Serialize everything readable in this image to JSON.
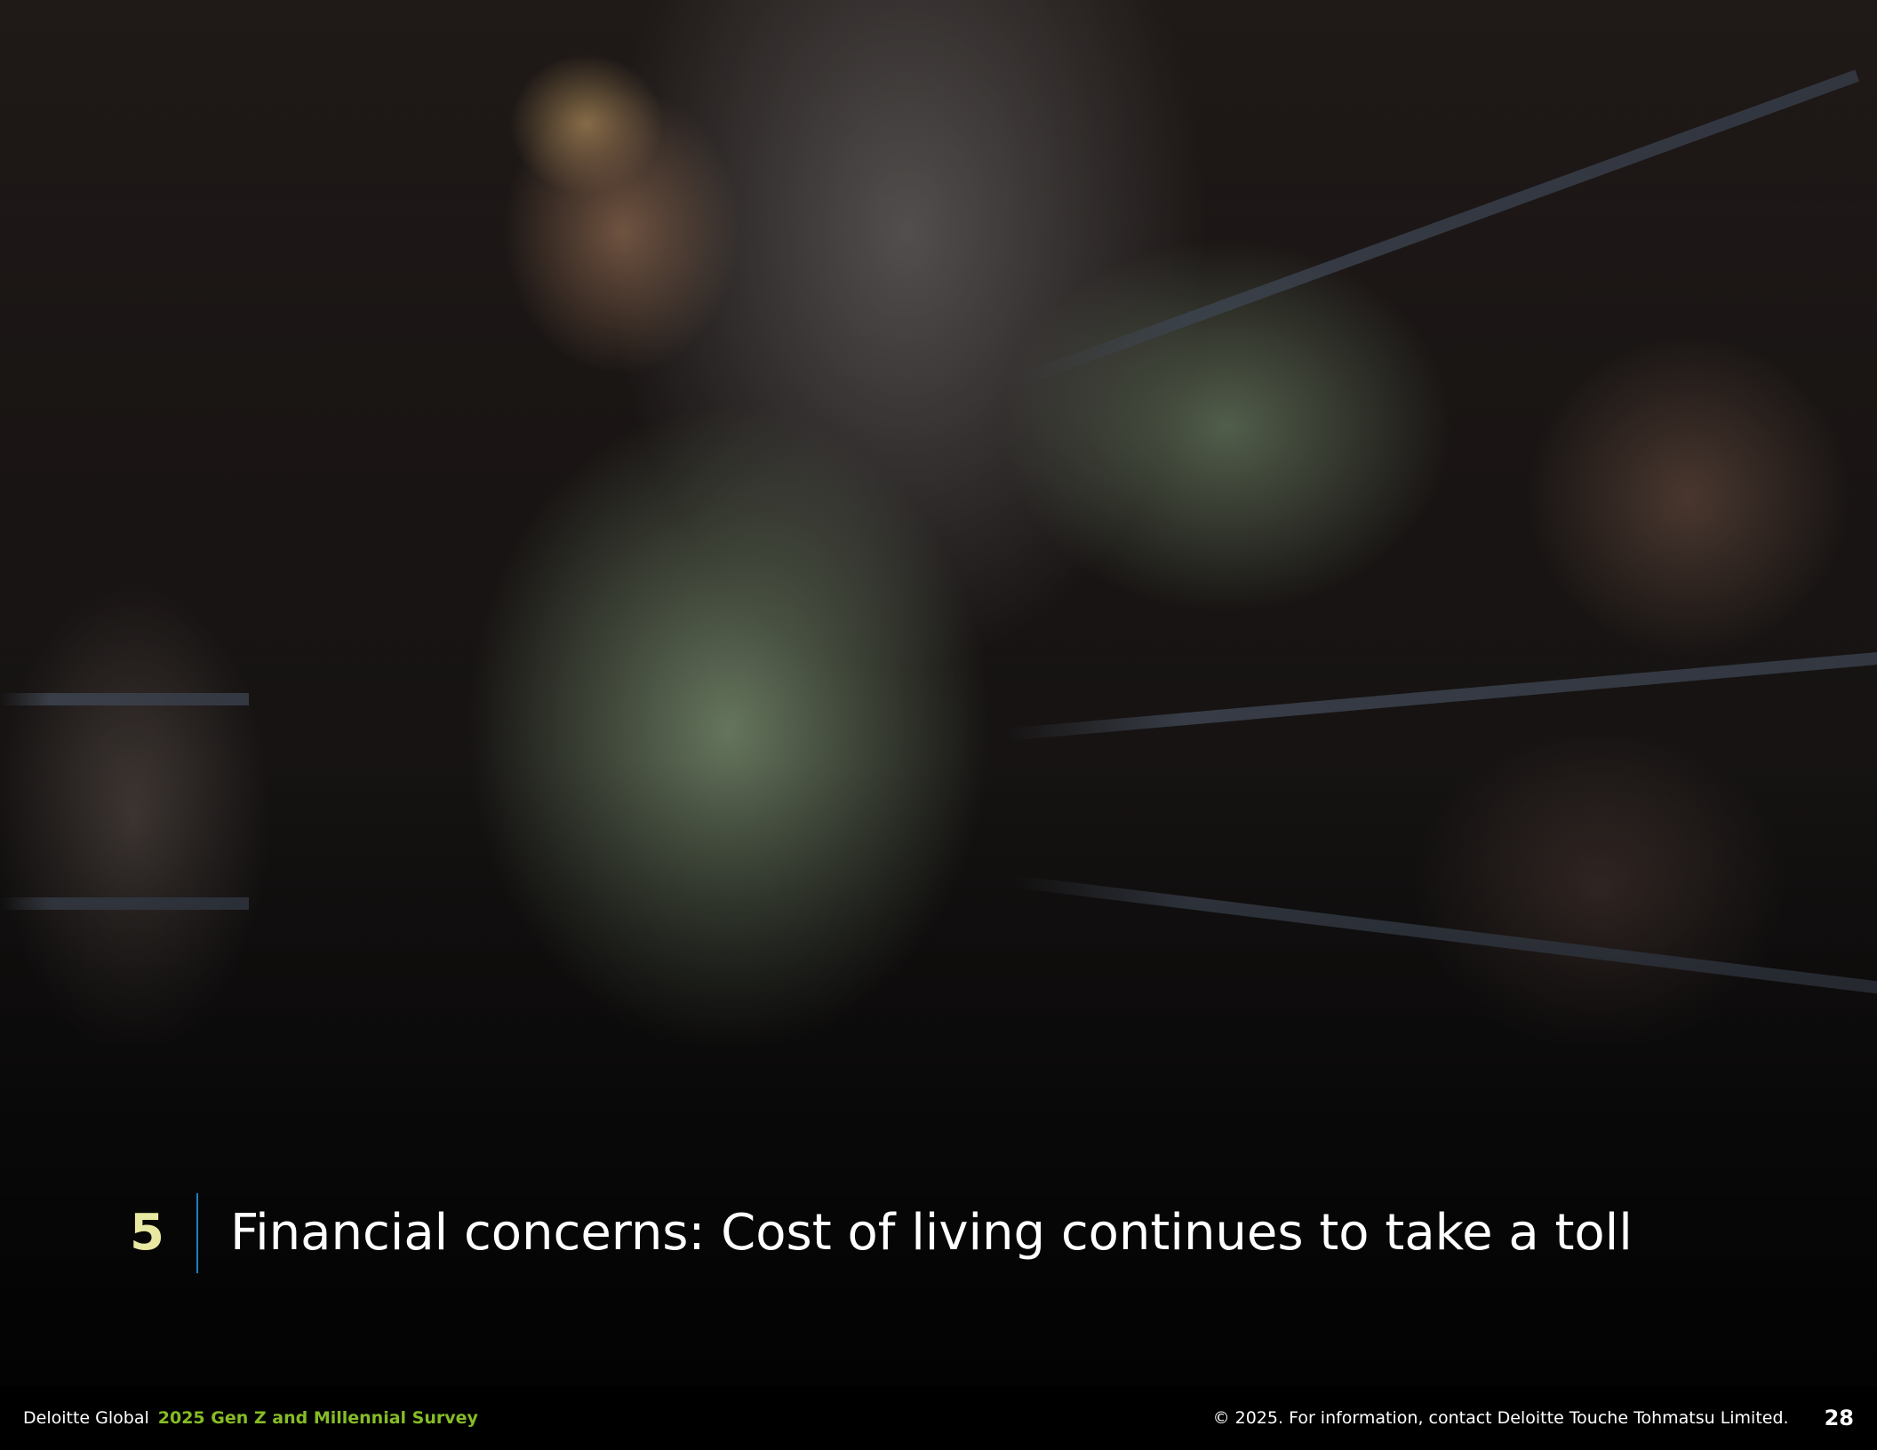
{
  "section": {
    "number": "5",
    "title": "Financial concerns: Cost of living continues to take a toll"
  },
  "footer": {
    "publisher": "Deloitte Global",
    "report_title": "2025 Gen Z and Millennial Survey",
    "copyright": "© 2025. For information, contact Deloitte Touche Tohmatsu Limited.",
    "page_number": "28"
  },
  "colors": {
    "section_number": "#e9e8a2",
    "divider": "#1d7fc1",
    "report_title": "#86bc25",
    "footer_background": "#000000"
  }
}
